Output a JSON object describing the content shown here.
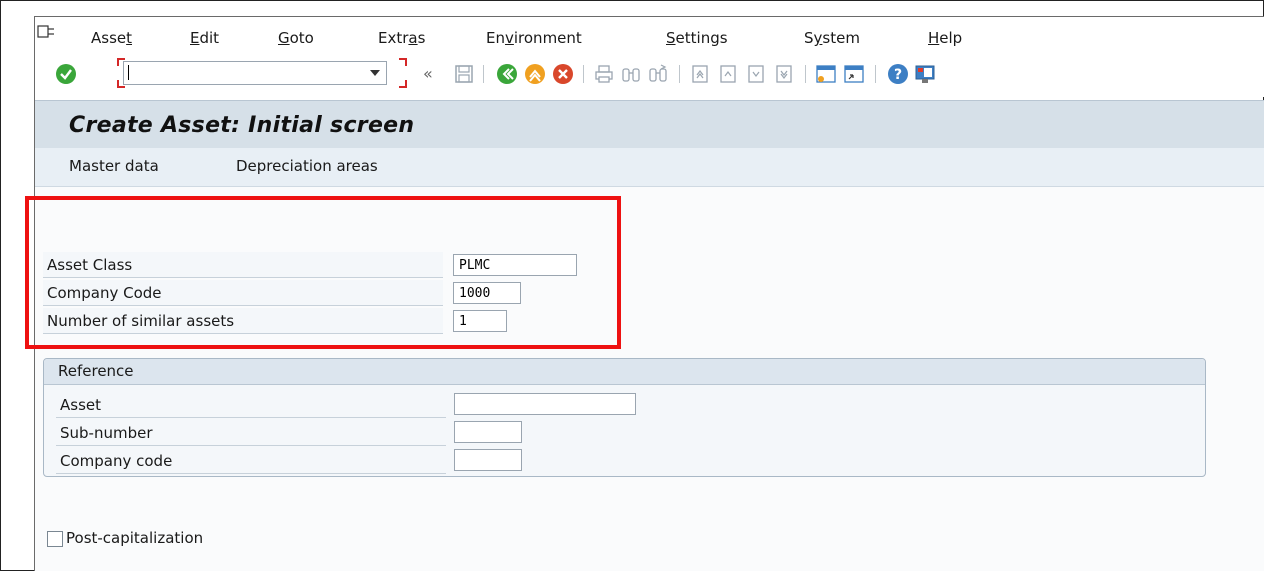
{
  "menu": {
    "items": [
      {
        "pre": "Asse",
        "ul": "t",
        "post": ""
      },
      {
        "pre": "",
        "ul": "E",
        "post": "dit"
      },
      {
        "pre": "",
        "ul": "G",
        "post": "oto"
      },
      {
        "pre": "Extr",
        "ul": "a",
        "post": "s"
      },
      {
        "pre": "En",
        "ul": "v",
        "post": "ironment"
      },
      {
        "pre": "",
        "ul": "S",
        "post": "ettings"
      },
      {
        "pre": "S",
        "ul": "y",
        "post": "stem"
      },
      {
        "pre": "",
        "ul": "H",
        "post": "elp"
      }
    ]
  },
  "toolbar": {
    "command_value": "",
    "history_chevron": "«",
    "icons": [
      "enter-icon",
      "save-icon",
      "back-icon",
      "exit-icon",
      "cancel-icon",
      "print-icon",
      "find-icon",
      "find-next-icon",
      "first-page-icon",
      "previous-page-icon",
      "next-page-icon",
      "last-page-icon",
      "create-session-icon",
      "create-shortcut-icon",
      "help-icon",
      "customize-layout-icon"
    ]
  },
  "screen": {
    "title": "Create Asset:  Initial screen"
  },
  "app_toolbar": {
    "master_data": "Master data",
    "depreciation_areas": "Depreciation areas"
  },
  "form": {
    "asset_class": {
      "label": "Asset Class",
      "value": "PLMC"
    },
    "company_code": {
      "label": "Company Code",
      "value": "1000"
    },
    "similar_assets": {
      "label": "Number of similar assets",
      "value": "1"
    }
  },
  "reference": {
    "title": "Reference",
    "asset": {
      "label": "Asset",
      "value": ""
    },
    "sub_number": {
      "label": "Sub-number",
      "value": ""
    },
    "company_code": {
      "label": "Company code",
      "value": ""
    }
  },
  "post_capitalization": {
    "label": "Post-capitalization",
    "checked": false
  },
  "colors": {
    "highlight": "#ee1111",
    "title_bar": "#d6e0e8",
    "enter_green": "#3aa63a",
    "exit_orange": "#f0a020",
    "cancel_red": "#d9472b"
  }
}
